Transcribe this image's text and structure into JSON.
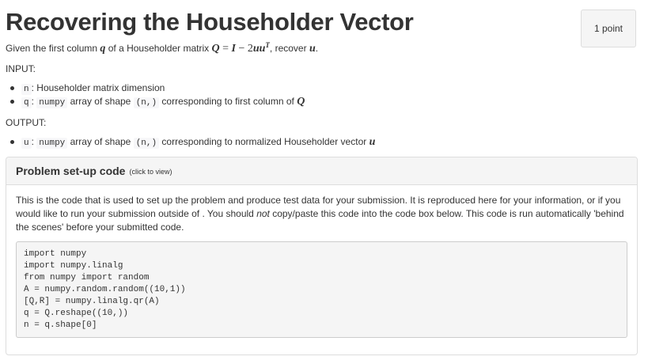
{
  "header": {
    "title": "Recovering the Householder Vector",
    "points": "1 point"
  },
  "intro": {
    "p1": "Given the first column ",
    "q": "q",
    "p2": " of a Householder matrix ",
    "formula_Q": "Q",
    "formula_eq": " = ",
    "formula_I": "I",
    "formula_minus": " − 2",
    "formula_uu": "uu",
    "formula_T": "T",
    "p3": ", recover ",
    "u": "u",
    "p4": "."
  },
  "input": {
    "label": "INPUT:",
    "items": [
      {
        "code": "n",
        "text": ": Householder matrix dimension"
      },
      {
        "code": "q",
        "sep": ": ",
        "code2": "numpy",
        "text": " array of shape ",
        "code3": "(n,)",
        "text2": " corresponding to first column of ",
        "math": "Q"
      }
    ]
  },
  "output": {
    "label": "OUTPUT:",
    "items": [
      {
        "code": "u",
        "sep": ": ",
        "code2": "numpy",
        "text": " array of shape ",
        "code3": "(n,)",
        "text2": " corresponding to normalized Householder vector ",
        "math": "u"
      }
    ]
  },
  "setup_panel": {
    "title": "Problem set-up code",
    "subtitle": "(click to view)",
    "desc1": "This is the code that is used to set up the problem and produce test data for your submission. It is reproduced here for your information, or if you would like to run your submission outside of . You should ",
    "desc_em": "not",
    "desc2": " copy/paste this code into the code box below. This code is run automatically 'behind the scenes' before your submitted code.",
    "code": "import numpy\nimport numpy.linalg\nfrom numpy import random\nA = numpy.random.random((10,1))\n[Q,R] = numpy.linalg.qr(A)\nq = Q.reshape((10,))\nn = q.shape[0]"
  }
}
